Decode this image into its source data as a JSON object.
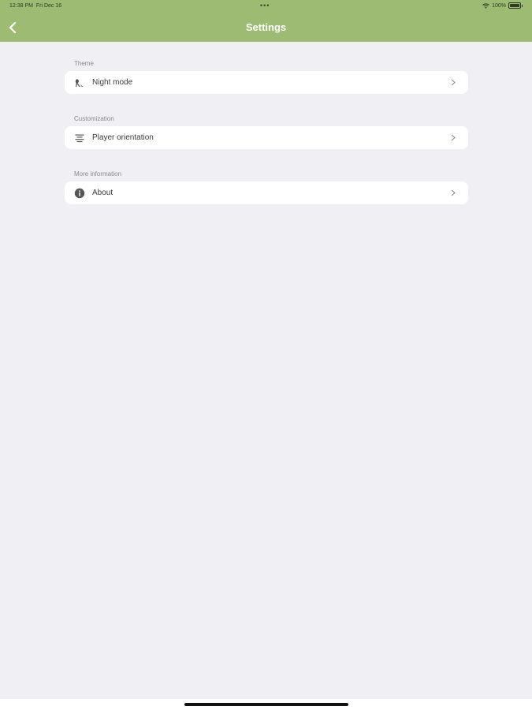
{
  "status_bar": {
    "time": "12:38 PM",
    "date": "Fri Dec 16",
    "dots": "•••",
    "battery": "100%"
  },
  "header": {
    "title": "Settings",
    "background_color": "#9dbb72"
  },
  "sections": [
    {
      "label": "Theme",
      "items": [
        {
          "label": "Night mode",
          "icon": "night-mode-icon"
        }
      ]
    },
    {
      "label": "Customization",
      "items": [
        {
          "label": "Player orientation",
          "icon": "orientation-icon"
        }
      ]
    },
    {
      "label": "More information",
      "items": [
        {
          "label": "About",
          "icon": "info-icon"
        }
      ]
    }
  ]
}
